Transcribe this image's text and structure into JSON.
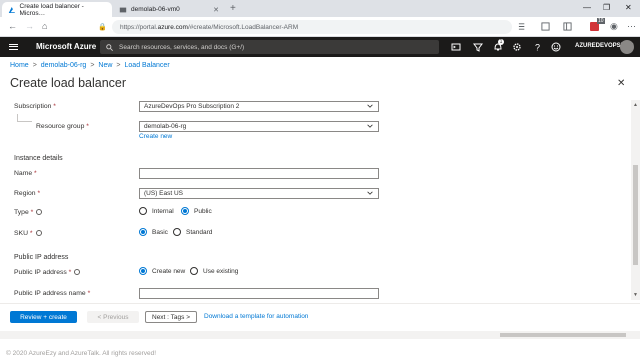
{
  "browser": {
    "tabs": [
      {
        "label": "Create load balancer - Micros…",
        "active": true
      },
      {
        "label": "demolab-06-vm0",
        "active": false
      }
    ],
    "new_tab": "+",
    "url_prefix": "https://portal.",
    "url_domain": "azure.com",
    "url_path": "/#create/Microsoft.LoadBalancer-ARM",
    "badge_count": "10"
  },
  "azure": {
    "brand": "Microsoft Azure",
    "search_placeholder": "Search resources, services, and docs (G+/)",
    "notifications_count": "1",
    "account": "AZUREDEVOPSPRO"
  },
  "breadcrumb": [
    "Home",
    "demolab-06-rg",
    "New",
    "Load Balancer"
  ],
  "page": {
    "title": "Create load balancer"
  },
  "form": {
    "subscription": {
      "label": "Subscription",
      "value": "AzureDevOps Pro Subscription 2"
    },
    "resource_group": {
      "label": "Resource group",
      "value": "demolab-06-rg",
      "create_new": "Create new"
    },
    "instance_details": "Instance details",
    "name": {
      "label": "Name",
      "value": ""
    },
    "region": {
      "label": "Region",
      "value": "(US) East US"
    },
    "type": {
      "label": "Type",
      "options": [
        "Internal",
        "Public"
      ],
      "selected": "Public"
    },
    "sku": {
      "label": "SKU",
      "options": [
        "Basic",
        "Standard"
      ],
      "selected": "Basic"
    },
    "public_ip_section": "Public IP address",
    "public_ip": {
      "label": "Public IP address",
      "options": [
        "Create new",
        "Use existing"
      ],
      "selected": "Create new"
    },
    "public_ip_name": {
      "label": "Public IP address name",
      "value": ""
    }
  },
  "footer": {
    "review_create": "Review + create",
    "previous": "< Previous",
    "next": "Next : Tags >",
    "download": "Download a template for automation"
  },
  "copyright": "© 2020 AzureEzy and AzureTalk. All rights reserved!",
  "colors": {
    "accent": "#0078d4",
    "topbar": "#1b1a19",
    "required": "#a4262c"
  }
}
